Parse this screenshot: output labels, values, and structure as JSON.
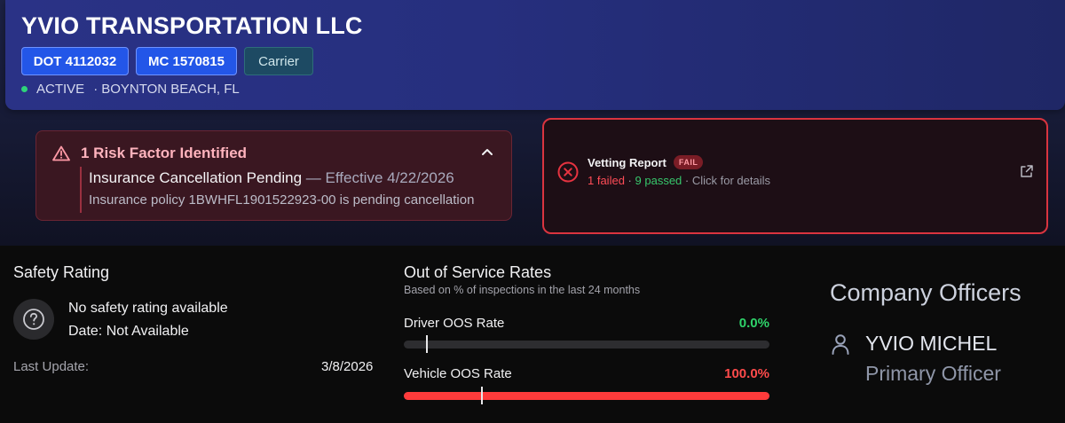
{
  "header": {
    "company_name": "YVIO TRANSPORTATION LLC",
    "dot_badge": "DOT 4112032",
    "mc_badge": "MC 1570815",
    "type_badge": "Carrier",
    "status": "ACTIVE",
    "location": "BOYNTON BEACH, FL"
  },
  "risk": {
    "title": "1 Risk Factor Identified",
    "item_title": "Insurance Cancellation Pending",
    "item_effective": "— Effective 4/22/2026",
    "item_description": "Insurance policy 1BWHFL1901522923-00 is pending cancellation"
  },
  "vetting": {
    "title": "Vetting Report",
    "badge": "FAIL",
    "failed": "1 failed",
    "separator": "·",
    "passed": "9 passed",
    "details": "· Click for details"
  },
  "safety": {
    "title": "Safety Rating",
    "rating_text": "No safety rating available",
    "date_text": "Date: Not Available",
    "last_update_label": "Last Update:",
    "last_update_value": "3/8/2026"
  },
  "oos": {
    "title": "Out of Service Rates",
    "subtitle": "Based on % of inspections in the last 24 months",
    "rates": [
      {
        "label": "Driver OOS Rate",
        "value_text": "0.0%",
        "value": 0.0,
        "national_avg_marker": 0.06,
        "color": "#2fd36a"
      },
      {
        "label": "Vehicle OOS Rate",
        "value_text": "100.0%",
        "value": 1.0,
        "national_avg_marker": 0.21,
        "color": "#ff4b4b"
      }
    ]
  },
  "officers": {
    "title": "Company Officers",
    "name": "YVIO MICHEL",
    "role": "Primary Officer"
  }
}
